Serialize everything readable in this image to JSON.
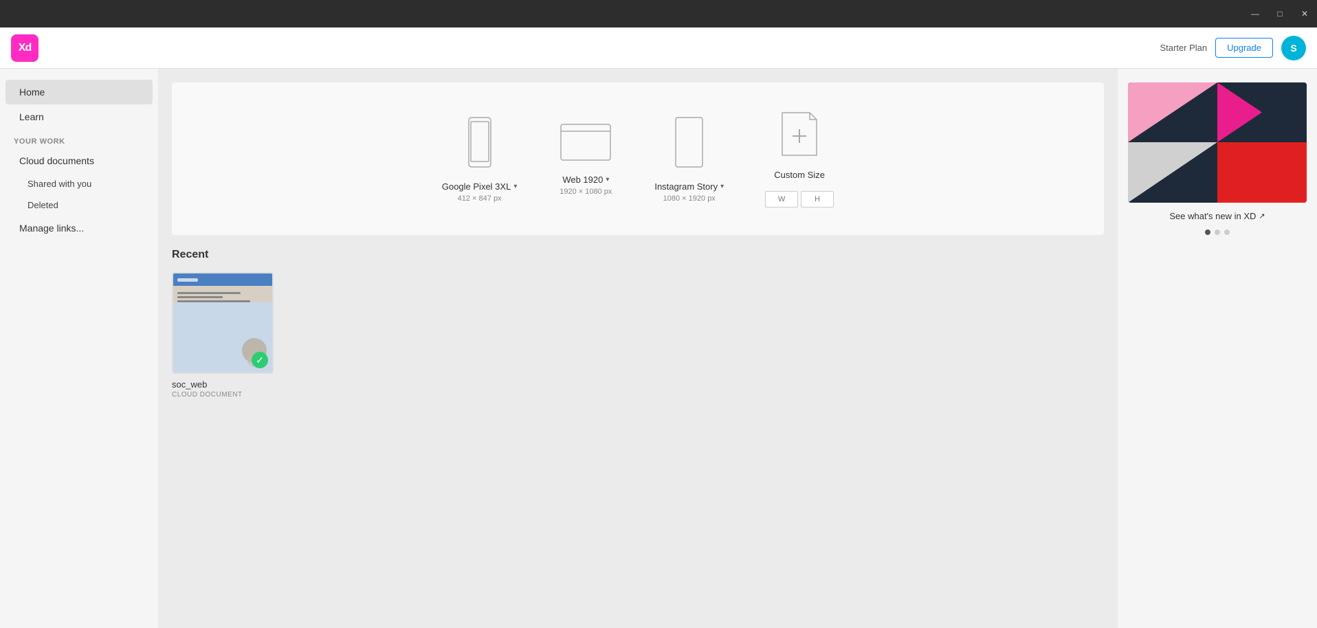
{
  "titlebar": {
    "minimize_label": "—",
    "maximize_label": "□",
    "close_label": "✕"
  },
  "header": {
    "logo_text": "Xd",
    "plan_text": "Starter Plan",
    "upgrade_label": "Upgrade",
    "avatar_initials": "S"
  },
  "sidebar": {
    "home_label": "Home",
    "learn_label": "Learn",
    "section_label": "YOUR WORK",
    "cloud_docs_label": "Cloud documents",
    "shared_label": "Shared with you",
    "deleted_label": "Deleted",
    "manage_links_label": "Manage links..."
  },
  "new_file": {
    "presets": [
      {
        "id": "google-pixel",
        "label": "Google Pixel 3XL",
        "dims": "412 × 847 px"
      },
      {
        "id": "web-1920",
        "label": "Web 1920",
        "dims": "1920 × 1080 px"
      },
      {
        "id": "instagram-story",
        "label": "Instagram Story",
        "dims": "1080 × 1920 px"
      },
      {
        "id": "custom-size",
        "label": "Custom Size",
        "dims": ""
      }
    ],
    "custom_w_placeholder": "W",
    "custom_h_placeholder": "H"
  },
  "right_panel": {
    "whats_new_text": "See what's new in XD",
    "whats_new_icon": "external-link-icon"
  },
  "recent": {
    "section_title": "Recent",
    "files": [
      {
        "name": "soc_web",
        "type": "CLOUD DOCUMENT",
        "synced": true
      }
    ]
  }
}
